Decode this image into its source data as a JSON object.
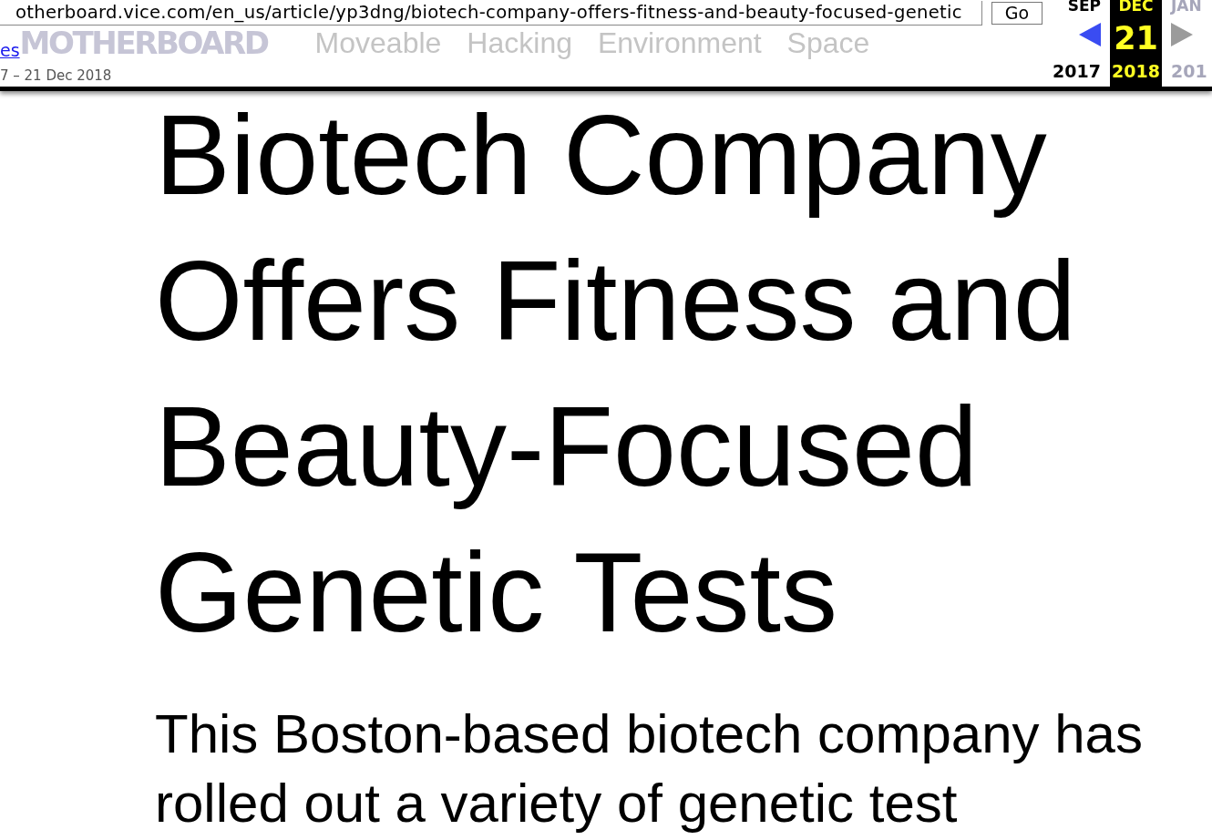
{
  "wayback_toolbar": {
    "url_field": {
      "value": "otherboard.vice.com/en_us/article/yp3dng/biotech-company-offers-fitness-and-beauty-focused-genetic"
    },
    "go_button": "Go",
    "link": "es",
    "capture_range": "7 – 21 Dec 2018",
    "calendar": {
      "months": [
        {
          "month": "SEP",
          "year": "2017",
          "selected": false,
          "disabled": false
        },
        {
          "month": "DEC",
          "day": "21",
          "year": "2018",
          "selected": true,
          "disabled": false
        },
        {
          "month": "JAN",
          "year": "201",
          "selected": false,
          "disabled": true
        }
      ],
      "prev_arrow": {
        "disabled": false
      },
      "next_arrow": {
        "disabled": true
      }
    }
  },
  "background_page": {
    "logo": "MOTHERBOARD",
    "nav": [
      "Moveable",
      "Hacking",
      "Environment",
      "Space"
    ]
  },
  "article": {
    "headline": "Biotech Company Offers Fitness and Beauty-Focused Genetic Tests",
    "summary": "This Boston-based biotech company has rolled out a variety of genetic test"
  }
}
